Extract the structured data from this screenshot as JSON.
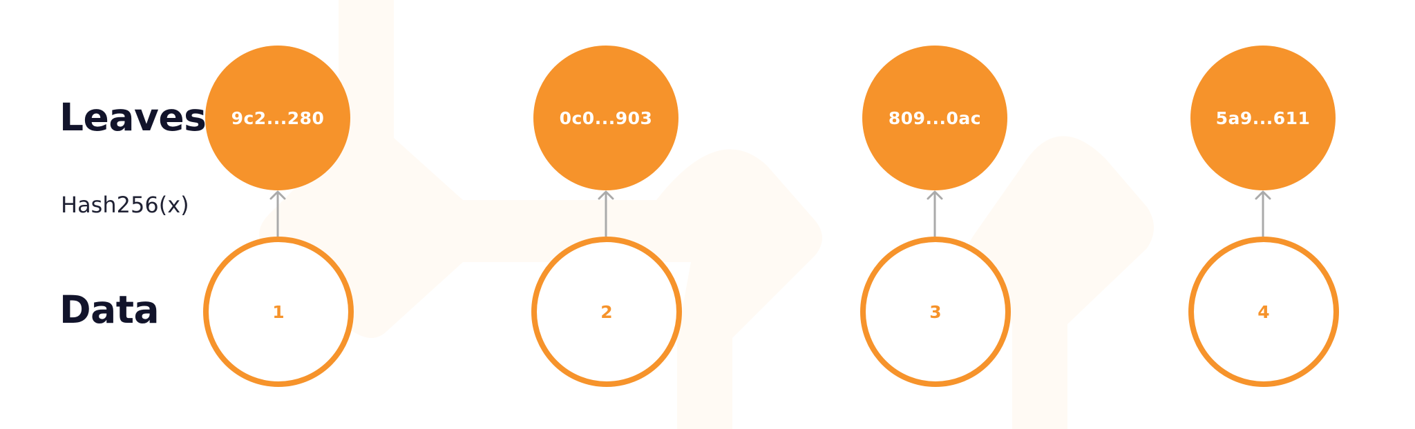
{
  "labels": {
    "leaves": "Leaves",
    "hash_function": "Hash256(x)",
    "data": "Data"
  },
  "leaves": [
    {
      "hash": "9c2...280"
    },
    {
      "hash": "0c0...903"
    },
    {
      "hash": "809...0ac"
    },
    {
      "hash": "5a9...611"
    }
  ],
  "data": [
    {
      "value": "1"
    },
    {
      "value": "2"
    },
    {
      "value": "3"
    },
    {
      "value": "4"
    }
  ],
  "colors": {
    "accent": "#f6932b",
    "leaf_text": "#ffffff",
    "heading": "#12142b",
    "arrow": "#aaaaaa",
    "watermark": "#fffaf4"
  }
}
